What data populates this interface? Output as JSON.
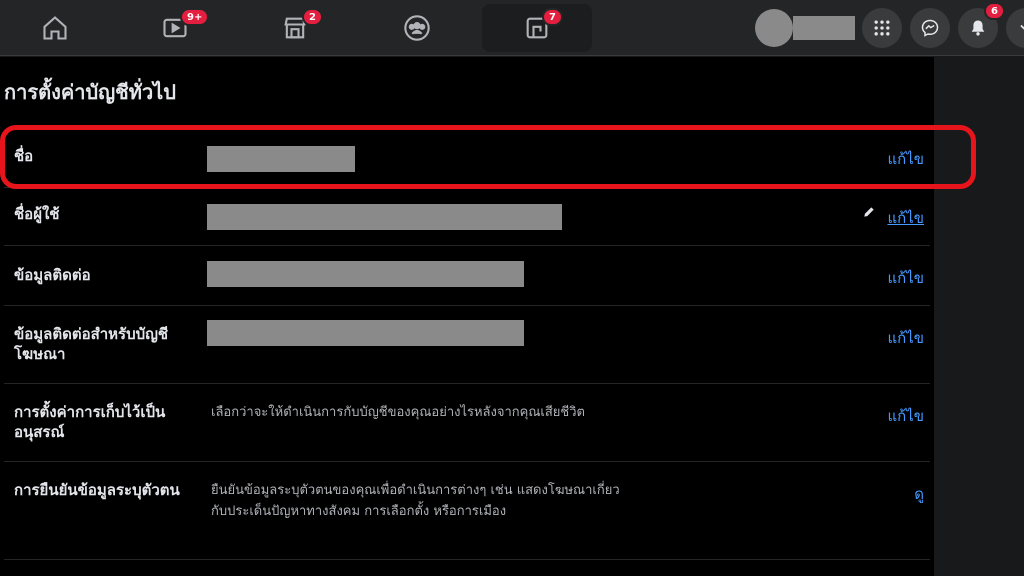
{
  "topbar": {
    "nav": [
      {
        "name": "home",
        "icon": "home-icon",
        "badge": ""
      },
      {
        "name": "watch",
        "icon": "video-icon",
        "badge": "9+"
      },
      {
        "name": "marketplace",
        "icon": "store-icon",
        "badge": "2"
      },
      {
        "name": "groups",
        "icon": "groups-icon",
        "badge": ""
      },
      {
        "name": "gaming",
        "icon": "gaming-icon",
        "badge": "7"
      }
    ],
    "notifications_badge": "6"
  },
  "page": {
    "title": "การตั้งค่าบัญชีทั่วไป"
  },
  "rows": [
    {
      "label": "ชื่อ",
      "action": "แก้ไข"
    },
    {
      "label": "ชื่อผู้ใช้",
      "action": "แก้ไข"
    },
    {
      "label": "ข้อมูลติดต่อ",
      "action": "แก้ไข"
    },
    {
      "label": "ข้อมูลติดต่อสำหรับบัญชีโฆษณา",
      "action": "แก้ไข"
    },
    {
      "label": "การตั้งค่าการเก็บไว้เป็นอนุสรณ์",
      "desc": "เลือกว่าจะให้ดำเนินการกับบัญชีของคุณอย่างไรหลังจากคุณเสียชีวิต",
      "action": "แก้ไข"
    },
    {
      "label": "การยืนยันข้อมูลระบุตัวตน",
      "desc": "ยืนยันข้อมูลระบุตัวตนของคุณเพื่อดำเนินการต่างๆ เช่น แสดงโฆษณาเกี่ยวกับประเด็นปัญหาทางสังคม การเลือกตั้ง หรือการเมือง",
      "action": "ดู"
    }
  ],
  "colors": {
    "accent": "#4599ff",
    "highlight": "#e8141c",
    "badge": "#e41e3f"
  }
}
